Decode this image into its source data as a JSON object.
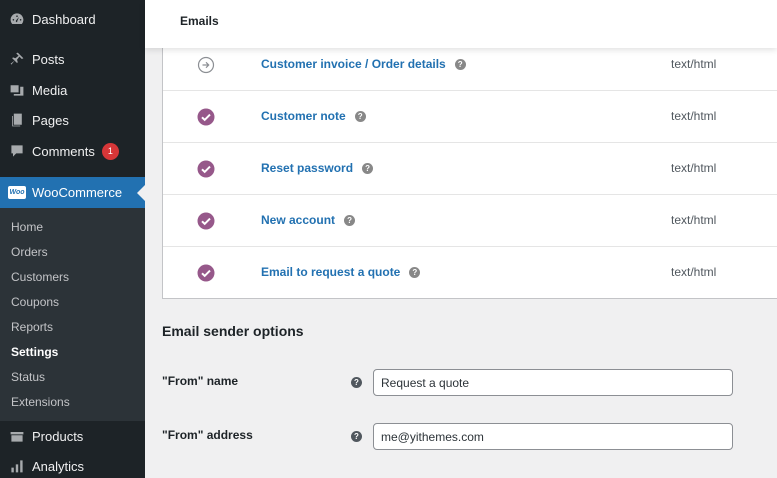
{
  "sidebar": {
    "items": [
      {
        "label": "Dashboard",
        "icon": "dashboard-icon"
      },
      {
        "label": "Posts",
        "icon": "pin-icon"
      },
      {
        "label": "Media",
        "icon": "media-icon"
      },
      {
        "label": "Pages",
        "icon": "pages-icon"
      },
      {
        "label": "Comments",
        "icon": "comment-icon",
        "badge": "1"
      },
      {
        "label": "WooCommerce",
        "icon": "woocommerce-icon"
      },
      {
        "label": "Products",
        "icon": "products-icon"
      },
      {
        "label": "Analytics",
        "icon": "analytics-icon"
      }
    ],
    "woo_logo_text": "Woo",
    "submenu": [
      "Home",
      "Orders",
      "Customers",
      "Coupons",
      "Reports",
      "Settings",
      "Status",
      "Extensions"
    ],
    "current_submenu": "Settings"
  },
  "header": {
    "title": "Emails"
  },
  "emails": [
    {
      "name": "Customer invoice / Order details",
      "status": "manual",
      "content_type": "text/html"
    },
    {
      "name": "Customer note",
      "status": "enabled",
      "content_type": "text/html"
    },
    {
      "name": "Reset password",
      "status": "enabled",
      "content_type": "text/html"
    },
    {
      "name": "New account",
      "status": "enabled",
      "content_type": "text/html"
    },
    {
      "name": "Email to request a quote",
      "status": "enabled",
      "content_type": "text/html"
    }
  ],
  "help_glyph": "?",
  "sender_options": {
    "title": "Email sender options",
    "from_name_label": "\"From\" name",
    "from_name_value": "Request a quote",
    "from_address_label": "\"From\" address",
    "from_address_value": "me@yithemes.com"
  },
  "colors": {
    "sidebar_bg": "#1d2327",
    "submenu_bg": "#2c3338",
    "active_bg": "#2271b1",
    "link": "#2271b1",
    "enabled_check": "#96588a",
    "badge": "#d63638"
  }
}
